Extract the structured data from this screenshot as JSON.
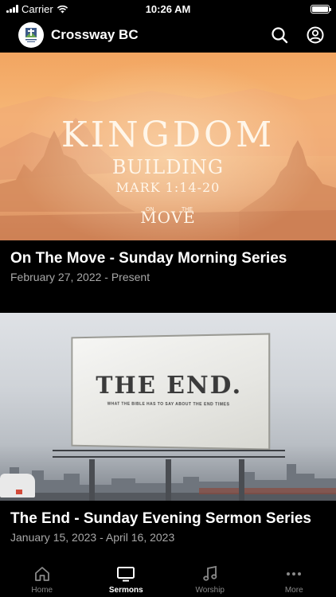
{
  "status_bar": {
    "carrier": "Carrier",
    "time": "10:26 AM"
  },
  "header": {
    "app_title": "Crossway BC",
    "logo_icon": "crossway-logo",
    "search_icon": "search-icon",
    "profile_icon": "user-circle-icon"
  },
  "series": [
    {
      "title": "On The Move - Sunday Morning Series",
      "date": "February 27, 2022 - Present",
      "artwork": {
        "line1": "KINGDOM",
        "line2": "BUILDING",
        "line3": "MARK 1:14-20",
        "on": "ON",
        "the": "THE",
        "move": "MOVE"
      }
    },
    {
      "title": "The End - Sunday Evening Sermon Series",
      "date": "January 15, 2023 - April 16, 2023",
      "artwork": {
        "headline": "THE END.",
        "subline": "WHAT THE BIBLE HAS TO SAY ABOUT THE END TIMES"
      }
    }
  ],
  "tabs": [
    {
      "label": "Home",
      "icon": "home-icon",
      "active": false
    },
    {
      "label": "Sermons",
      "icon": "tv-icon",
      "active": true
    },
    {
      "label": "Worship",
      "icon": "music-note-icon",
      "active": false
    },
    {
      "label": "More",
      "icon": "more-dots-icon",
      "active": false
    }
  ],
  "colors": {
    "background": "#000000",
    "text_primary": "#ffffff",
    "text_secondary": "#a8a8a8",
    "tab_inactive": "#8a8a8a"
  }
}
